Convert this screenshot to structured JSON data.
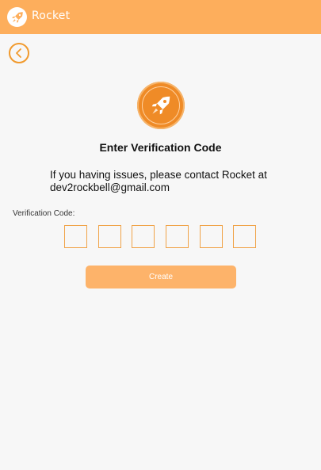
{
  "app_bar": {
    "title": "Rocket",
    "logo_icon": "rocket-icon",
    "background_color": "#fdae5c"
  },
  "navigation": {
    "back_icon": "chevron-left-icon"
  },
  "hero": {
    "logo_icon": "rocket-icon",
    "accent_color": "#ef8b27"
  },
  "content": {
    "title": "Enter Verification Code",
    "help_line_1": "If you having issues, please contact Rocket at",
    "help_line_2": "dev2rockbell@gmail.com"
  },
  "verification": {
    "label": "Verification Code:",
    "digits": [
      "",
      "",
      "",
      "",
      "",
      ""
    ]
  },
  "actions": {
    "create_label": "Create",
    "button_color": "#fdb36a"
  }
}
